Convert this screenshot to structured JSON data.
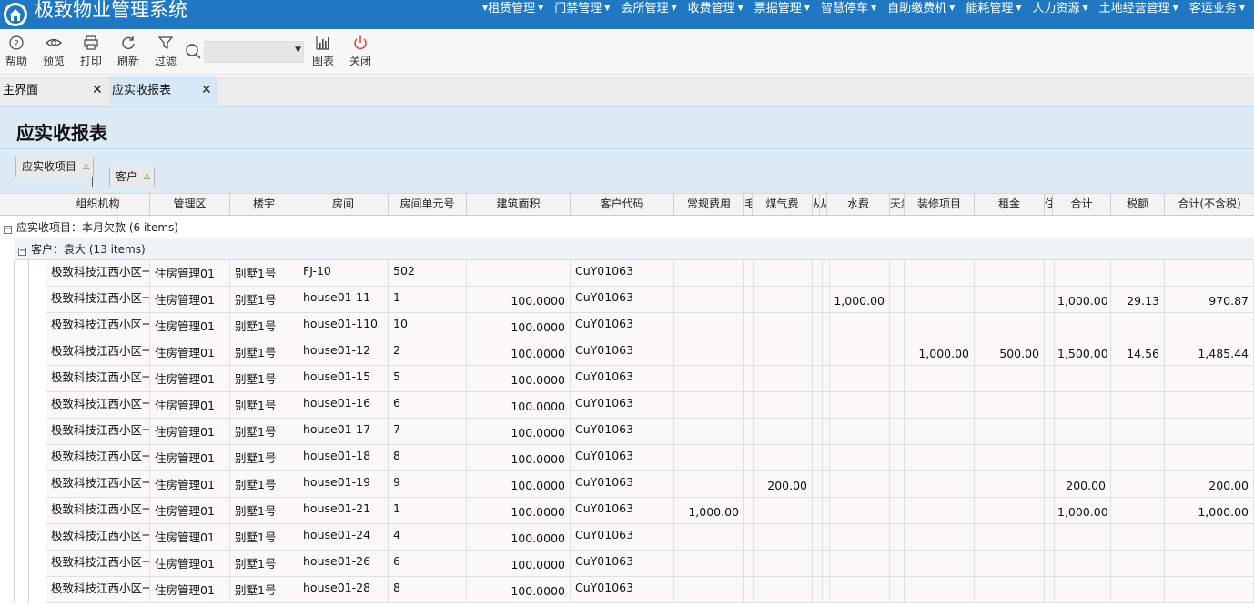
{
  "app": {
    "title": "极致物业管理系统",
    "nav": [
      "租赁管理",
      "门禁管理",
      "会所管理",
      "收费管理",
      "票据管理",
      "智慧停车",
      "自助缴费机",
      "能耗管理",
      "人力资源",
      "土地经营管理",
      "客运业务"
    ]
  },
  "toolbar": {
    "help": "帮助",
    "preview": "预览",
    "print": "打印",
    "refresh": "刷新",
    "filter": "过滤",
    "search_placeholder": "",
    "chart": "图表",
    "close": "关闭"
  },
  "tabs": [
    {
      "label": "主界面",
      "close": "✕"
    },
    {
      "label": "应实收报表",
      "close": "✕"
    }
  ],
  "page": {
    "title": "应实收报表",
    "group_chips": [
      "应实收项目",
      "客户"
    ]
  },
  "grid": {
    "columns": [
      "组织机构",
      "管理区",
      "楼宇",
      "房间",
      "房间单元号",
      "建筑面积",
      "客户代码",
      "常规费用",
      "毛",
      "煤气费",
      "从",
      "从",
      "水费",
      "天然",
      "装修项目",
      "租金",
      "住",
      "合计",
      "税额",
      "合计(不含税)"
    ],
    "group1": "应实收项目：本月欠款  (6 items)",
    "group2": "客户：袁大  (13 items)",
    "rows": [
      {
        "org": "极致科技江西小区一期",
        "area": "住房管理01",
        "building": "别墅1号",
        "room": "FJ-10",
        "unit": "502",
        "size": "",
        "customer": "CuY01063",
        "regular": "",
        "gas": "",
        "water": "",
        "decoration": "",
        "rent": "",
        "total": "",
        "tax": "",
        "total_ex": ""
      },
      {
        "org": "极致科技江西小区一期",
        "area": "住房管理01",
        "building": "别墅1号",
        "room": "house01-11",
        "unit": "1",
        "size": "100.0000",
        "customer": "CuY01063",
        "regular": "",
        "gas": "",
        "water": "1,000.00",
        "decoration": "",
        "rent": "",
        "total": "1,000.00",
        "tax": "29.13",
        "total_ex": "970.87"
      },
      {
        "org": "极致科技江西小区一期",
        "area": "住房管理01",
        "building": "别墅1号",
        "room": "house01-110",
        "unit": "10",
        "size": "100.0000",
        "customer": "CuY01063",
        "regular": "",
        "gas": "",
        "water": "",
        "decoration": "",
        "rent": "",
        "total": "",
        "tax": "",
        "total_ex": ""
      },
      {
        "org": "极致科技江西小区一期",
        "area": "住房管理01",
        "building": "别墅1号",
        "room": "house01-12",
        "unit": "2",
        "size": "100.0000",
        "customer": "CuY01063",
        "regular": "",
        "gas": "",
        "water": "",
        "decoration": "1,000.00",
        "rent": "500.00",
        "total": "1,500.00",
        "tax": "14.56",
        "total_ex": "1,485.44"
      },
      {
        "org": "极致科技江西小区一期",
        "area": "住房管理01",
        "building": "别墅1号",
        "room": "house01-15",
        "unit": "5",
        "size": "100.0000",
        "customer": "CuY01063",
        "regular": "",
        "gas": "",
        "water": "",
        "decoration": "",
        "rent": "",
        "total": "",
        "tax": "",
        "total_ex": ""
      },
      {
        "org": "极致科技江西小区一期",
        "area": "住房管理01",
        "building": "别墅1号",
        "room": "house01-16",
        "unit": "6",
        "size": "100.0000",
        "customer": "CuY01063",
        "regular": "",
        "gas": "",
        "water": "",
        "decoration": "",
        "rent": "",
        "total": "",
        "tax": "",
        "total_ex": ""
      },
      {
        "org": "极致科技江西小区一期",
        "area": "住房管理01",
        "building": "别墅1号",
        "room": "house01-17",
        "unit": "7",
        "size": "100.0000",
        "customer": "CuY01063",
        "regular": "",
        "gas": "",
        "water": "",
        "decoration": "",
        "rent": "",
        "total": "",
        "tax": "",
        "total_ex": ""
      },
      {
        "org": "极致科技江西小区一期",
        "area": "住房管理01",
        "building": "别墅1号",
        "room": "house01-18",
        "unit": "8",
        "size": "100.0000",
        "customer": "CuY01063",
        "regular": "",
        "gas": "",
        "water": "",
        "decoration": "",
        "rent": "",
        "total": "",
        "tax": "",
        "total_ex": ""
      },
      {
        "org": "极致科技江西小区一期",
        "area": "住房管理01",
        "building": "别墅1号",
        "room": "house01-19",
        "unit": "9",
        "size": "100.0000",
        "customer": "CuY01063",
        "regular": "",
        "gas": "200.00",
        "water": "",
        "decoration": "",
        "rent": "",
        "total": "200.00",
        "tax": "",
        "total_ex": "200.00"
      },
      {
        "org": "极致科技江西小区一期",
        "area": "住房管理01",
        "building": "别墅1号",
        "room": "house01-21",
        "unit": "1",
        "size": "100.0000",
        "customer": "CuY01063",
        "regular": "1,000.00",
        "gas": "",
        "water": "",
        "decoration": "",
        "rent": "",
        "total": "1,000.00",
        "tax": "",
        "total_ex": "1,000.00"
      },
      {
        "org": "极致科技江西小区一期",
        "area": "住房管理01",
        "building": "别墅1号",
        "room": "house01-24",
        "unit": "4",
        "size": "100.0000",
        "customer": "CuY01063",
        "regular": "",
        "gas": "",
        "water": "",
        "decoration": "",
        "rent": "",
        "total": "",
        "tax": "",
        "total_ex": ""
      },
      {
        "org": "极致科技江西小区一期",
        "area": "住房管理01",
        "building": "别墅1号",
        "room": "house01-26",
        "unit": "6",
        "size": "100.0000",
        "customer": "CuY01063",
        "regular": "",
        "gas": "",
        "water": "",
        "decoration": "",
        "rent": "",
        "total": "",
        "tax": "",
        "total_ex": ""
      },
      {
        "org": "极致科技江西小区一期",
        "area": "住房管理01",
        "building": "别墅1号",
        "room": "house01-28",
        "unit": "8",
        "size": "100.0000",
        "customer": "CuY01063",
        "regular": "",
        "gas": "",
        "water": "",
        "decoration": "",
        "rent": "",
        "total": "",
        "tax": "",
        "total_ex": ""
      }
    ]
  },
  "colors": {
    "topbar": "#1f78c1",
    "active_tab": "#d6e8f7",
    "header_band": "#dceaf5",
    "row_bg": "#fbf7fb"
  }
}
